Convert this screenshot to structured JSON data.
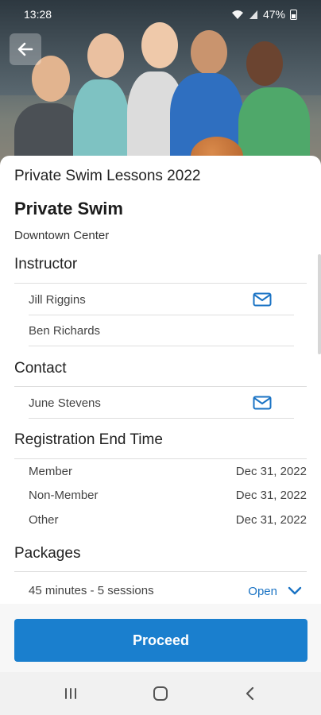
{
  "status_bar": {
    "time": "13:28",
    "battery": "47%"
  },
  "event": {
    "title": "Private Swim Lessons 2022",
    "name": "Private Swim",
    "location": "Downtown Center"
  },
  "instructor": {
    "heading": "Instructor",
    "people": [
      "Jill Riggins",
      "Ben Richards"
    ]
  },
  "contact": {
    "heading": "Contact",
    "people": [
      "June Stevens"
    ]
  },
  "registration": {
    "heading": "Registration End Time",
    "rows": [
      {
        "label": "Member",
        "value": "Dec 31, 2022"
      },
      {
        "label": "Non-Member",
        "value": "Dec 31, 2022"
      },
      {
        "label": "Other",
        "value": "Dec 31, 2022"
      }
    ]
  },
  "packages": {
    "heading": "Packages",
    "items": [
      {
        "label": "45 minutes - 5 sessions",
        "status": "Open"
      }
    ]
  },
  "actions": {
    "proceed_label": "Proceed"
  },
  "colors": {
    "accent": "#1a7fce",
    "link": "#1a73c4",
    "divider": "#dedede"
  },
  "icons": [
    "back-arrow-icon",
    "mail-icon",
    "chevron-down-icon",
    "recent-apps-icon",
    "home-icon",
    "back-nav-icon",
    "wifi-icon",
    "signal-icon",
    "battery-icon"
  ]
}
